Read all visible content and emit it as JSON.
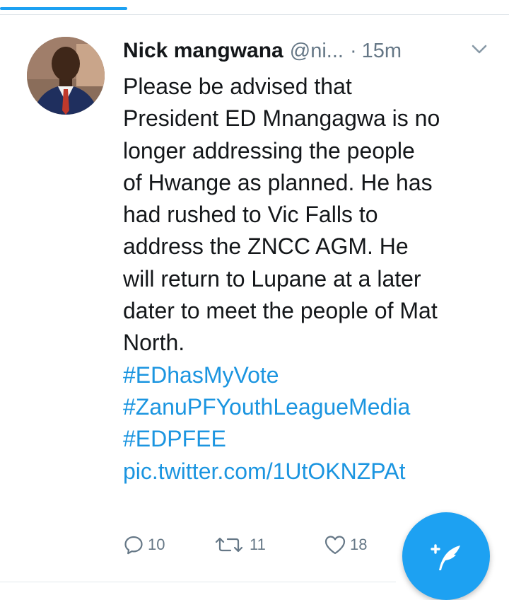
{
  "tweet": {
    "display_name": "Nick mangwana",
    "handle": "@ni...",
    "separator": "·",
    "time": "15m",
    "lines": [
      "Please be advised that",
      "President ED Mnangagwa is no",
      "longer addressing the people",
      "of Hwange as planned. He has",
      "had rushed to Vic Falls to",
      "address the ZNCC AGM. He",
      "will return to Lupane at a later",
      "dater to meet the people of Mat",
      "North."
    ],
    "hashtags": [
      "#EDhasMyVote",
      "#ZanuPFYouthLeagueMedia",
      "#EDPFEE"
    ],
    "pic_link": "pic.twitter.com/1UtOKNZPAt"
  },
  "actions": {
    "reply_count": "10",
    "retweet_count": "11",
    "like_count": "18"
  },
  "colors": {
    "accent": "#1da1f2",
    "link": "#1b95e0",
    "muted": "#657786"
  },
  "icons": [
    "chevron-down-icon",
    "reply-icon",
    "retweet-icon",
    "heart-icon",
    "compose-tweet-icon"
  ]
}
